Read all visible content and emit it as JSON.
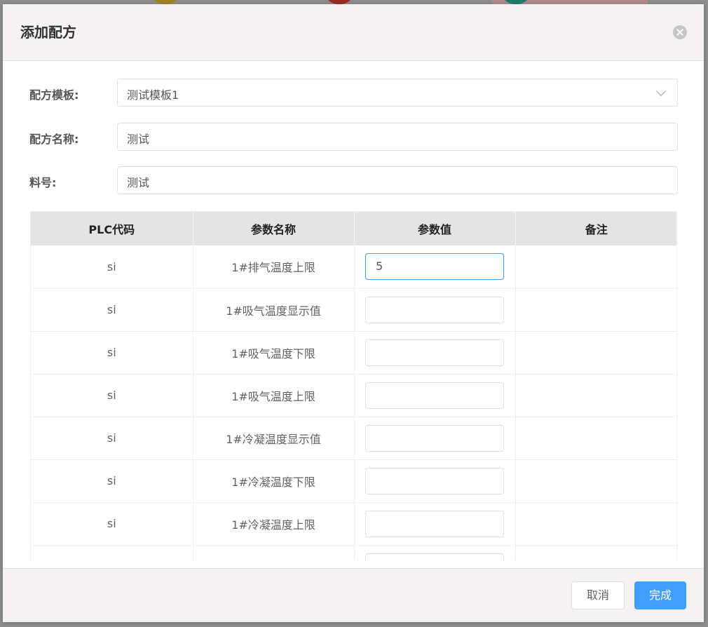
{
  "dialog": {
    "title": "添加配方"
  },
  "form": {
    "template": {
      "label": "配方模板:",
      "value": "测试模板1"
    },
    "name": {
      "label": "配方名称:",
      "value": "测试"
    },
    "material": {
      "label": "料号:",
      "value": "测试"
    }
  },
  "table": {
    "headers": [
      "PLC代码",
      "参数名称",
      "参数值",
      "备注"
    ],
    "rows": [
      {
        "code": "si",
        "name": "1#排气温度上限",
        "value": "5",
        "note": ""
      },
      {
        "code": "si",
        "name": "1#吸气温度显示值",
        "value": "",
        "note": ""
      },
      {
        "code": "si",
        "name": "1#吸气温度下限",
        "value": "",
        "note": ""
      },
      {
        "code": "si",
        "name": "1#吸气温度上限",
        "value": "",
        "note": ""
      },
      {
        "code": "si",
        "name": "1#冷凝温度显示值",
        "value": "",
        "note": ""
      },
      {
        "code": "si",
        "name": "1#冷凝温度下限",
        "value": "",
        "note": ""
      },
      {
        "code": "si",
        "name": "1#冷凝温度上限",
        "value": "",
        "note": ""
      },
      {
        "code": "",
        "name": "",
        "value": "",
        "note": ""
      }
    ]
  },
  "footer": {
    "cancel_label": "取消",
    "confirm_label": "完成"
  },
  "colors": {
    "primary": "#409eff",
    "header_bg": "#f6f2f2",
    "table_header_bg": "#e4e4e4"
  }
}
